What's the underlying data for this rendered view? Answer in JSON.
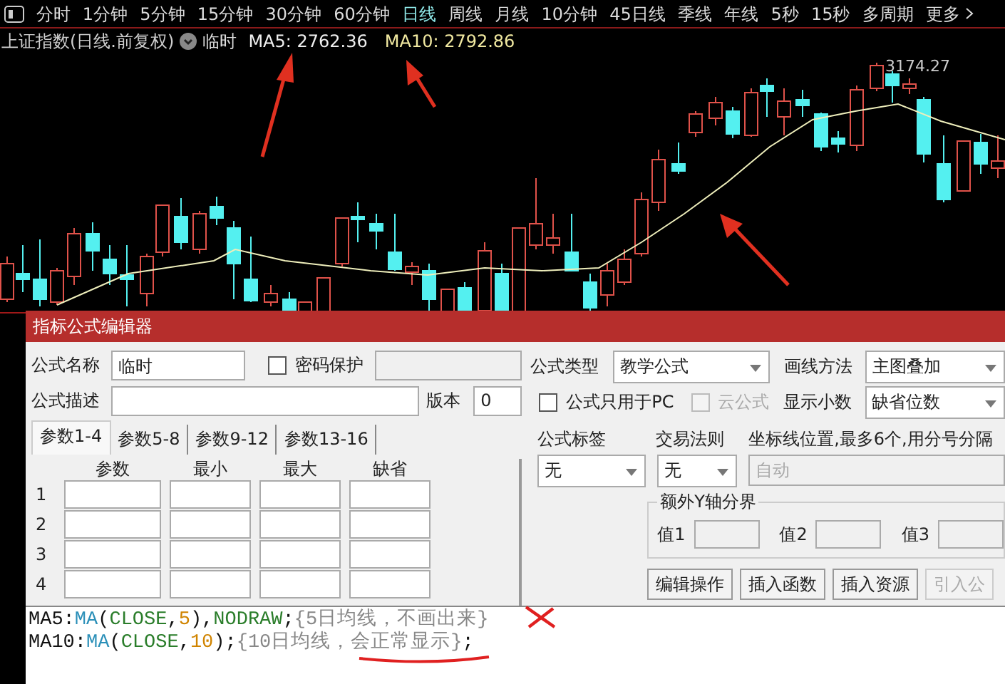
{
  "toolbar": {
    "periods": [
      {
        "label": "分时",
        "selected": false
      },
      {
        "label": "1分钟",
        "selected": false
      },
      {
        "label": "5分钟",
        "selected": false
      },
      {
        "label": "15分钟",
        "selected": false
      },
      {
        "label": "30分钟",
        "selected": false
      },
      {
        "label": "60分钟",
        "selected": false
      },
      {
        "label": "日线",
        "selected": true
      },
      {
        "label": "周线",
        "selected": false
      },
      {
        "label": "月线",
        "selected": false
      },
      {
        "label": "10分钟",
        "selected": false
      },
      {
        "label": "45日线",
        "selected": false
      },
      {
        "label": "季线",
        "selected": false
      },
      {
        "label": "年线",
        "selected": false
      },
      {
        "label": "5秒",
        "selected": false
      },
      {
        "label": "15秒",
        "selected": false
      },
      {
        "label": "多周期",
        "selected": false
      }
    ],
    "more": "更多"
  },
  "info": {
    "title": "上证指数(日线.前复权)",
    "indicator": "临时",
    "ma5": "MA5: 2762.36",
    "ma10": "MA10: 2792.86"
  },
  "chart": {
    "peak_label": "3174.27"
  },
  "dialog": {
    "title": "指标公式编辑器",
    "name_label": "公式名称",
    "name_value": "临时",
    "password": {
      "label": "密码保护",
      "checked": false
    },
    "desc_label": "公式描述",
    "version_label": "版本",
    "version_value": "0",
    "param_tabs": [
      {
        "label": "参数1-4",
        "selected": true
      },
      {
        "label": "参数5-8",
        "selected": false
      },
      {
        "label": "参数9-12",
        "selected": false
      },
      {
        "label": "参数13-16",
        "selected": false
      }
    ],
    "param_headers": [
      "参数",
      "最小",
      "最大",
      "缺省"
    ],
    "param_rows": [
      "1",
      "2",
      "3",
      "4"
    ],
    "type_label": "公式类型",
    "type_value": "教学公式",
    "draw_label": "画线方法",
    "draw_value": "主图叠加",
    "pc_only": {
      "label": "公式只用于PC",
      "checked": false,
      "disabled": false
    },
    "cloud": {
      "label": "云公式",
      "checked": false,
      "disabled": true
    },
    "decimals_label": "显示小数",
    "decimals_value": "缺省位数",
    "tag_label": "公式标签",
    "tag_value": "无",
    "rule_label": "交易法则",
    "rule_value": "无",
    "axis_label": "坐标线位置,最多6个,用分号分隔",
    "axis_value": "自动",
    "axis_disabled": true,
    "extra_y": {
      "legend": "额外Y轴分界",
      "values": [
        "值1",
        "值2",
        "值3"
      ]
    },
    "buttons": [
      {
        "label": "编辑操作",
        "disabled": false
      },
      {
        "label": "插入函数",
        "disabled": false
      },
      {
        "label": "插入资源",
        "disabled": false
      },
      {
        "label": "引入公",
        "disabled": true
      }
    ]
  },
  "code": [
    {
      "tokens": [
        {
          "kind": "plain",
          "text": "MA5:"
        },
        {
          "kind": "func",
          "text": "MA"
        },
        {
          "kind": "plain",
          "text": "("
        },
        {
          "kind": "var",
          "text": "CLOSE"
        },
        {
          "kind": "plain",
          "text": ","
        },
        {
          "kind": "num",
          "text": "5"
        },
        {
          "kind": "plain",
          "text": "),"
        },
        {
          "kind": "var",
          "text": "NODRAW"
        },
        {
          "kind": "plain",
          "text": ";"
        },
        {
          "kind": "comment",
          "text": "{5日均线，不画出来}"
        }
      ]
    },
    {
      "tokens": [
        {
          "kind": "plain",
          "text": "MA10:"
        },
        {
          "kind": "func",
          "text": "MA"
        },
        {
          "kind": "plain",
          "text": "("
        },
        {
          "kind": "var",
          "text": "CLOSE"
        },
        {
          "kind": "plain",
          "text": ","
        },
        {
          "kind": "num",
          "text": "10"
        },
        {
          "kind": "plain",
          "text": ");"
        },
        {
          "kind": "comment",
          "text": "{10日均线，会正常显示}"
        },
        {
          "kind": "plain",
          "text": ";"
        }
      ]
    }
  ]
}
